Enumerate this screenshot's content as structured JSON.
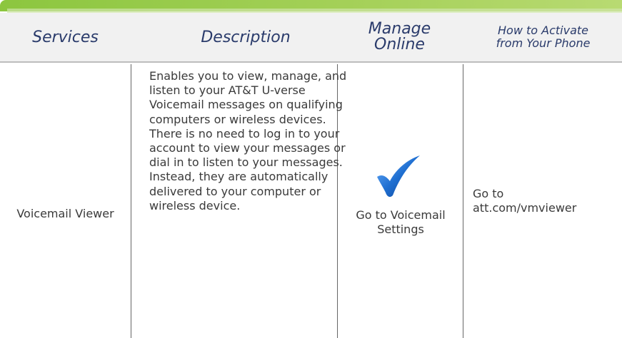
{
  "header": {
    "services": "Services",
    "description": "Description",
    "manage_online_line1": "Manage",
    "manage_online_line2": "Online",
    "activate_line1": "How to Activate",
    "activate_line2": "from Your Phone"
  },
  "row": {
    "service": "Voicemail Viewer",
    "description": "Enables you to view, manage, and listen to your AT&T U-verse Voicemail messages on qualifying computers or wireless devices. There is no need to log in to your account to view your messages or dial in to listen to your messages. Instead, they are automatically delivered to your computer or wireless device.",
    "manage_online_icon": "checkmark-icon",
    "manage_online": "Go to Voicemail Settings",
    "activate_line1": "Go to",
    "activate_line2": "att.com/vmviewer"
  },
  "colors": {
    "top_bar": "#8cc63f",
    "header_text": "#2a3b6b",
    "checkmark": "#1f6fd1"
  }
}
